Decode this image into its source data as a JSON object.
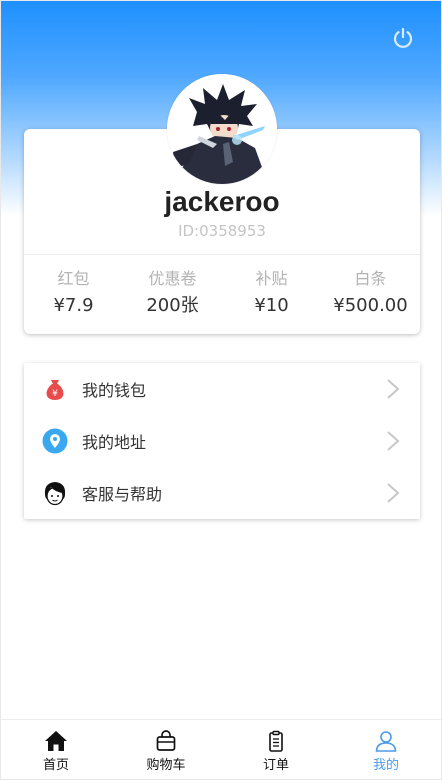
{
  "header": {
    "logout_icon": "power-icon"
  },
  "profile": {
    "avatar_alt": "user avatar",
    "username": "jackeroo",
    "user_id": "ID:0358953"
  },
  "stats": [
    {
      "label": "红包",
      "value": "¥7.9"
    },
    {
      "label": "优惠卷",
      "value": "200张"
    },
    {
      "label": "补贴",
      "value": "¥10"
    },
    {
      "label": "白条",
      "value": "¥500.00"
    }
  ],
  "menu": [
    {
      "label": "我的钱包",
      "icon": "wallet-icon"
    },
    {
      "label": "我的地址",
      "icon": "location-icon"
    },
    {
      "label": "客服与帮助",
      "icon": "customer-service-icon"
    }
  ],
  "tabbar": [
    {
      "label": "首页",
      "icon": "home-icon"
    },
    {
      "label": "购物车",
      "icon": "cart-icon"
    },
    {
      "label": "订单",
      "icon": "order-icon"
    },
    {
      "label": "我的",
      "icon": "user-icon",
      "active": true
    }
  ],
  "colors": {
    "accent": "#4a9ce8",
    "header_top": "#1e90ff"
  }
}
